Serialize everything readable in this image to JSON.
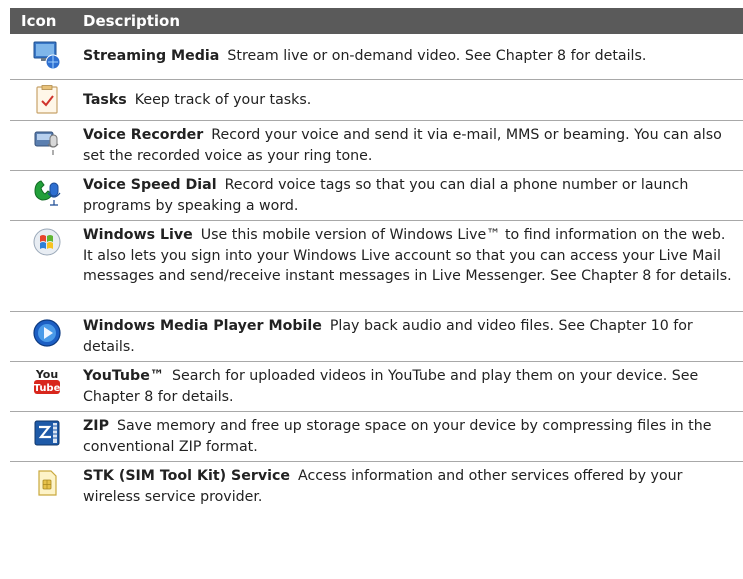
{
  "header": {
    "col_icon": "Icon",
    "col_description": "Description"
  },
  "rows": [
    {
      "name": "Streaming Media",
      "desc": "Stream live or on-demand video. See Chapter 8 for details.",
      "icon": "streaming-media-icon"
    },
    {
      "name": "Tasks",
      "desc": "Keep track of your tasks.",
      "icon": "tasks-icon"
    },
    {
      "name": "Voice Recorder",
      "desc": "Record your voice and send it via e-mail, MMS or beaming. You can also set the recorded voice as your ring tone.",
      "icon": "voice-recorder-icon"
    },
    {
      "name": "Voice Speed Dial",
      "desc": "Record voice tags so that you can dial a phone number or launch programs by speaking a word.",
      "icon": "voice-speed-dial-icon"
    },
    {
      "name": "Windows Live",
      "desc": "Use this mobile version of Windows Live™ to find information on the web. It also lets you sign into your Windows Live account so that you can access your Live Mail messages and send/receive instant messages in Live Messenger. See Chapter 8 for details.",
      "icon": "windows-live-icon"
    },
    {
      "name": "Windows Media Player Mobile",
      "desc": "Play back audio and video files. See Chapter 10 for details.",
      "icon": "media-player-icon"
    },
    {
      "name": "YouTube™",
      "desc": "Search for uploaded videos in YouTube and play them on your device. See Chapter 8 for details.",
      "icon": "youtube-icon",
      "icon_text_top": "You",
      "icon_text_bottom": "Tube"
    },
    {
      "name": "ZIP",
      "desc": "Save memory and free up storage space on your device by compressing files in the conventional ZIP format.",
      "icon": "zip-icon"
    },
    {
      "name": "STK (SIM Tool Kit) Service",
      "desc": "Access information and other services offered by your wireless service provider.",
      "icon": "sim-card-icon"
    }
  ]
}
